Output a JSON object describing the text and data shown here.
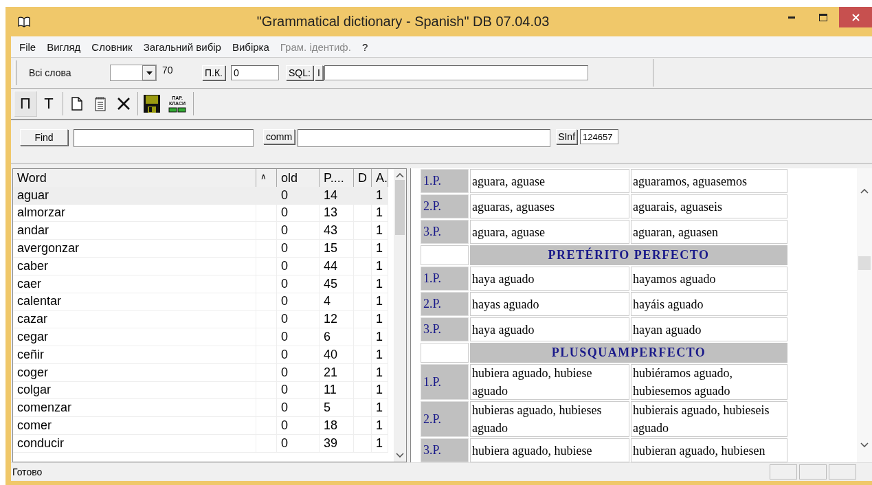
{
  "window": {
    "title": "\"Grammatical dictionary - Spanish\" DB 07.04.03"
  },
  "menu": [
    {
      "label": "File",
      "disabled": false
    },
    {
      "label": "Вигляд",
      "disabled": false
    },
    {
      "label": "Словник",
      "disabled": false
    },
    {
      "label": "Загальний вибір",
      "disabled": false
    },
    {
      "label": "Вибірка",
      "disabled": false
    },
    {
      "label": "Грам. ідентиф.",
      "disabled": true
    },
    {
      "label": "?",
      "disabled": false
    }
  ],
  "filter_bar": {
    "label": "Всі слова",
    "count": "70",
    "pk_button": "П.К.",
    "pk_value": "0",
    "sql_button": "SQL:",
    "sql_toggle": "I"
  },
  "tool_bar": {
    "buttons": [
      {
        "kind": "text",
        "label": "П",
        "selected": true
      },
      {
        "kind": "text",
        "label": "Т",
        "selected": false
      },
      {
        "kind": "new"
      },
      {
        "kind": "notes"
      },
      {
        "kind": "delete"
      },
      {
        "kind": "save"
      },
      {
        "kind": "classes",
        "label": "ПАР. КЛАСИ"
      }
    ]
  },
  "search_bar": {
    "find_button": "Find",
    "comm_button": "comm",
    "sinf_button": "SInf",
    "sinf_value": "124657"
  },
  "table": {
    "columns": [
      "Word",
      "∧",
      "old",
      "P....",
      "D",
      "A."
    ],
    "rows": [
      {
        "word": "aguar",
        "old": "0",
        "p": "14",
        "a": "1",
        "selected": true
      },
      {
        "word": "almorzar",
        "old": "0",
        "p": "13",
        "a": "1",
        "selected": false
      },
      {
        "word": "andar",
        "old": "0",
        "p": "43",
        "a": "1",
        "selected": false
      },
      {
        "word": "avergonzar",
        "old": "0",
        "p": "15",
        "a": "1",
        "selected": false
      },
      {
        "word": "caber",
        "old": "0",
        "p": "44",
        "a": "1",
        "selected": false
      },
      {
        "word": "caer",
        "old": "0",
        "p": "45",
        "a": "1",
        "selected": false
      },
      {
        "word": "calentar",
        "old": "0",
        "p": "4",
        "a": "1",
        "selected": false
      },
      {
        "word": "cazar",
        "old": "0",
        "p": "12",
        "a": "1",
        "selected": false
      },
      {
        "word": "cegar",
        "old": "0",
        "p": "6",
        "a": "1",
        "selected": false
      },
      {
        "word": "ceñir",
        "old": "0",
        "p": "40",
        "a": "1",
        "selected": false
      },
      {
        "word": "coger",
        "old": "0",
        "p": "21",
        "a": "1",
        "selected": false
      },
      {
        "word": "colgar",
        "old": "0",
        "p": "11",
        "a": "1",
        "selected": false
      },
      {
        "word": "comenzar",
        "old": "0",
        "p": "5",
        "a": "1",
        "selected": false
      },
      {
        "word": "comer",
        "old": "0",
        "p": "18",
        "a": "1",
        "selected": false
      },
      {
        "word": "conducir",
        "old": "0",
        "p": "39",
        "a": "1",
        "selected": false
      }
    ]
  },
  "conjugation": [
    {
      "kind": "row",
      "person": "1.P.",
      "singular": "aguara, aguase",
      "plural": "aguaramos, aguasemos"
    },
    {
      "kind": "row",
      "person": "2.P.",
      "singular": "aguaras, aguases",
      "plural": "aguarais, aguaseis"
    },
    {
      "kind": "row",
      "person": "3.P.",
      "singular": "aguara, aguase",
      "plural": "aguaran, aguasen"
    },
    {
      "kind": "header",
      "title": "PRETÉRITO PERFECTO"
    },
    {
      "kind": "row",
      "person": "1.P.",
      "singular": "haya aguado",
      "plural": "hayamos aguado"
    },
    {
      "kind": "row",
      "person": "2.P.",
      "singular": "hayas aguado",
      "plural": "hayáis aguado"
    },
    {
      "kind": "row",
      "person": "3.P.",
      "singular": "haya aguado",
      "plural": "hayan aguado"
    },
    {
      "kind": "header",
      "title": "PLUSQUAMPERFECTO"
    },
    {
      "kind": "row",
      "person": "1.P.",
      "singular": "hubiera aguado, hubiese aguado",
      "plural": "hubiéramos aguado, hubiesemos aguado"
    },
    {
      "kind": "row",
      "person": "2.P.",
      "singular": "hubieras aguado, hubieses aguado",
      "plural": "hubierais aguado, hubieseis aguado"
    },
    {
      "kind": "row",
      "person": "3.P.",
      "singular": "hubiera aguado, hubiese",
      "plural": "hubieran aguado, hubiesen"
    }
  ],
  "status_bar": {
    "text": "Готово"
  }
}
